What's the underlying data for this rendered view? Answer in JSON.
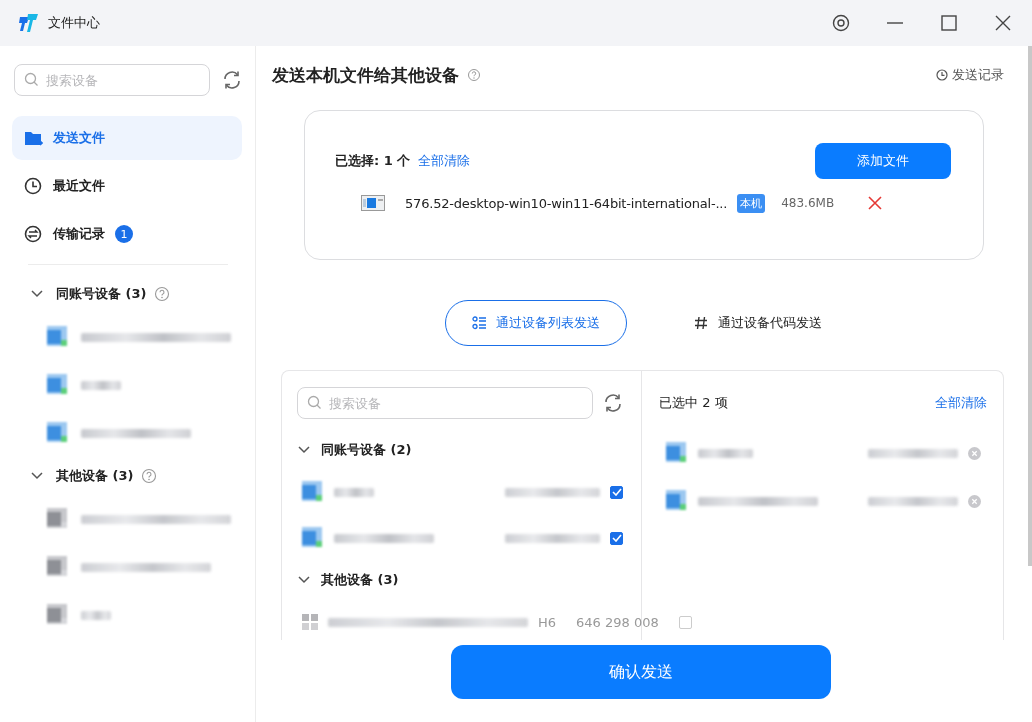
{
  "window": {
    "title": "文件中心"
  },
  "sidebar": {
    "search": {
      "placeholder": "搜索设备"
    },
    "nav": [
      {
        "kind": "send",
        "label": "发送文件",
        "selected": true
      },
      {
        "kind": "recent",
        "label": "最近文件",
        "selected": false
      },
      {
        "kind": "history",
        "label": "传输记录",
        "selected": false,
        "badge": "1"
      }
    ],
    "groups": [
      {
        "title": "同账号设备 (3)",
        "expanded": true,
        "devices": [
          {
            "kind": "own"
          },
          {
            "kind": "own"
          },
          {
            "kind": "own"
          }
        ]
      },
      {
        "title": "其他设备 (3)",
        "expanded": true,
        "devices": [
          {
            "kind": "other"
          },
          {
            "kind": "other"
          },
          {
            "kind": "other"
          }
        ]
      }
    ]
  },
  "main": {
    "title": "发送本机文件给其他设备",
    "history_link": "发送记录",
    "file_panel": {
      "selected_count": "已选择: 1 个",
      "clear_link": "全部清除",
      "add_button": "添加文件",
      "files": [
        {
          "name": "576.52-desktop-win10-win11-64bit-international-...",
          "tag": "本机",
          "size": "483.6MB"
        }
      ]
    },
    "send_modes": [
      {
        "kind": "list",
        "label": "通过设备列表发送",
        "selected": true
      },
      {
        "kind": "code",
        "label": "通过设备代码发送",
        "selected": false
      }
    ],
    "device_picker": {
      "search": {
        "placeholder": "搜索设备"
      },
      "groups": [
        {
          "title": "同账号设备 (2)",
          "expanded": true,
          "devices": [
            {
              "kind": "own",
              "checked": true
            },
            {
              "kind": "own",
              "checked": true
            }
          ]
        },
        {
          "title": "其他设备 (3)",
          "expanded": true,
          "devices": [
            {
              "kind": "windows",
              "checked": false,
              "name_tail": "H6",
              "code": "646 298 008"
            }
          ]
        }
      ],
      "selected_panel": {
        "header": "已选中 2 项",
        "clear_link": "全部清除",
        "items": [
          {
            "kind": "own"
          },
          {
            "kind": "own"
          }
        ]
      }
    },
    "confirm_button": "确认发送"
  }
}
